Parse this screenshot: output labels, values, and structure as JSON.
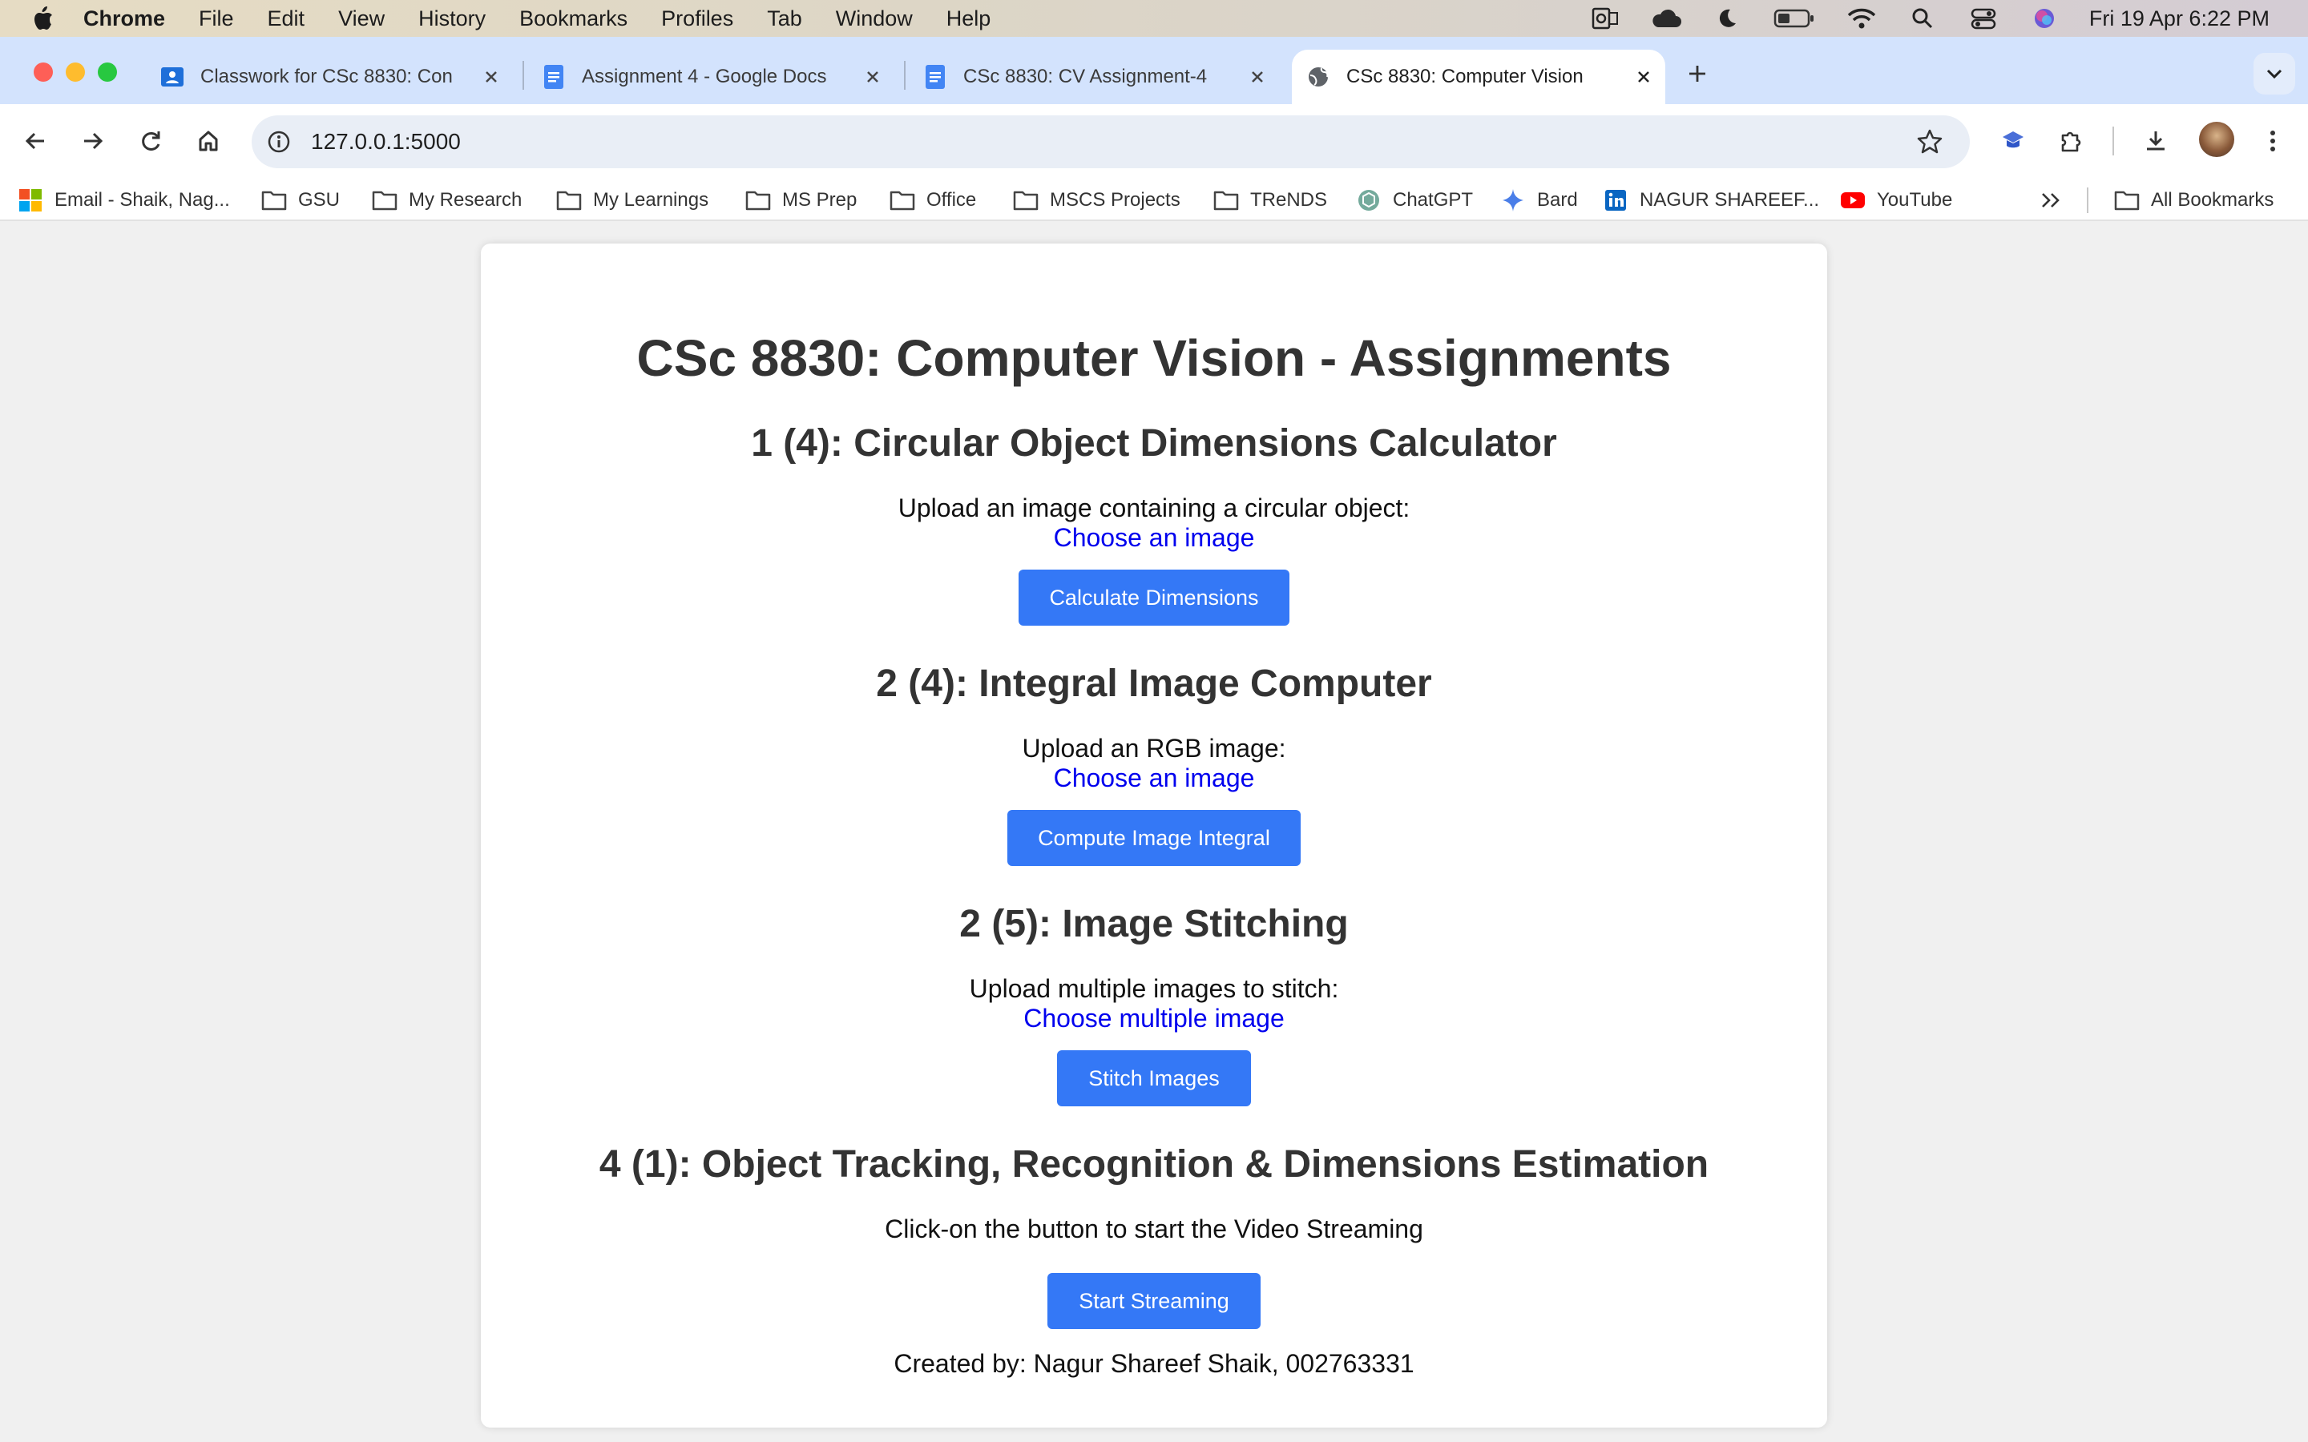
{
  "menubar": {
    "app": "Chrome",
    "items": [
      "File",
      "Edit",
      "View",
      "History",
      "Bookmarks",
      "Profiles",
      "Tab",
      "Window",
      "Help"
    ],
    "clock": "Fri 19 Apr  6:22 PM"
  },
  "tabs": [
    {
      "title": "Classwork for CSc 8830: Con",
      "icon": "classroom-icon"
    },
    {
      "title": "Assignment 4 - Google Docs",
      "icon": "docs-icon"
    },
    {
      "title": "CSc 8830: CV Assignment-4",
      "icon": "docs-icon"
    },
    {
      "title": "CSc 8830: Computer Vision",
      "icon": "globe-icon",
      "active": true
    }
  ],
  "address": {
    "url": "127.0.0.1:5000"
  },
  "bookmarks": [
    {
      "label": "Email - Shaik, Nag...",
      "icon": "microsoft-icon"
    },
    {
      "label": "GSU",
      "icon": "folder-icon"
    },
    {
      "label": "My Research",
      "icon": "folder-icon"
    },
    {
      "label": "My Learnings",
      "icon": "folder-icon"
    },
    {
      "label": "MS Prep",
      "icon": "folder-icon"
    },
    {
      "label": "Office",
      "icon": "folder-icon"
    },
    {
      "label": "MSCS Projects",
      "icon": "folder-icon"
    },
    {
      "label": "TReNDS",
      "icon": "folder-icon"
    },
    {
      "label": "ChatGPT",
      "icon": "chatgpt-icon"
    },
    {
      "label": "Bard",
      "icon": "bard-icon"
    },
    {
      "label": "NAGUR SHAREEF...",
      "icon": "linkedin-icon"
    },
    {
      "label": "YouTube",
      "icon": "youtube-icon"
    }
  ],
  "all_bookmarks": "All Bookmarks",
  "page": {
    "title": "CSc 8830: Computer Vision - Assignments",
    "sections": [
      {
        "heading": "1 (4): Circular Object Dimensions Calculator",
        "prompt": "Upload an image containing a circular object:",
        "link": "Choose an image",
        "button": "Calculate Dimensions"
      },
      {
        "heading": "2 (4): Integral Image Computer",
        "prompt": "Upload an RGB image:",
        "link": "Choose an image",
        "button": "Compute Image Integral"
      },
      {
        "heading": "2 (5): Image Stitching",
        "prompt": "Upload multiple images to stitch:",
        "link": "Choose multiple image",
        "button": "Stitch Images"
      },
      {
        "heading": "4 (1): Object Tracking, Recognition & Dimensions Estimation",
        "prompt": "Click-on the button to start the Video Streaming",
        "button": "Start Streaming"
      }
    ],
    "footer": "Created by: Nagur Shareef Shaik, 002763331"
  },
  "colors": {
    "accent": "#3478f6",
    "link": "#0000ee",
    "tabstrip": "#d3e3fd"
  }
}
